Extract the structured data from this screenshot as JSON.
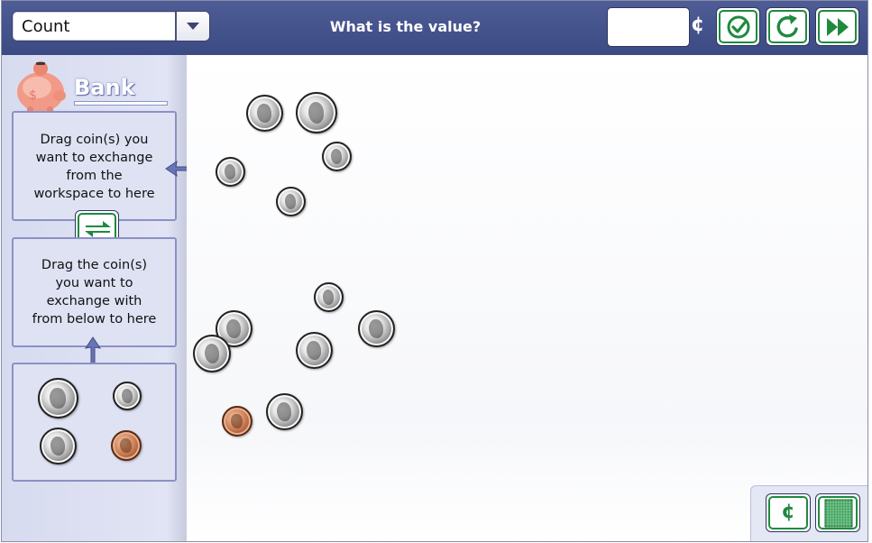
{
  "toolbar": {
    "mode_value": "Count",
    "prompt": "What is the value?",
    "answer_value": "",
    "currency_symbol": "¢"
  },
  "sidebar": {
    "bank_title": "Bank",
    "exchange_from_text_lines": [
      "Drag coin(s) you",
      "want to exchange",
      "from the",
      "workspace to here"
    ],
    "exchange_with_text_lines": [
      "Drag the coin(s)",
      "you want to",
      "exchange with",
      "from below to here"
    ],
    "bank_coins": [
      "quarter",
      "dime",
      "nickel",
      "penny"
    ]
  },
  "workspace": {
    "coins": [
      "nickel",
      "quarter",
      "dime",
      "dime",
      "dime",
      "dime",
      "nickel",
      "nickel",
      "quarter",
      "nickel",
      "penny",
      "nickel"
    ]
  },
  "tray": {
    "cent_label": "¢"
  },
  "icons": {
    "check": "check-circle-icon",
    "reset": "refresh-icon",
    "next": "fast-forward-icon",
    "exchange": "exchange-arrows-icon",
    "grid": "hundred-grid-icon",
    "bank": "piggy-bank-icon"
  },
  "colors": {
    "header": "#46538c",
    "accent_green": "#1f8a3e",
    "panel_border": "#8b91c5"
  }
}
